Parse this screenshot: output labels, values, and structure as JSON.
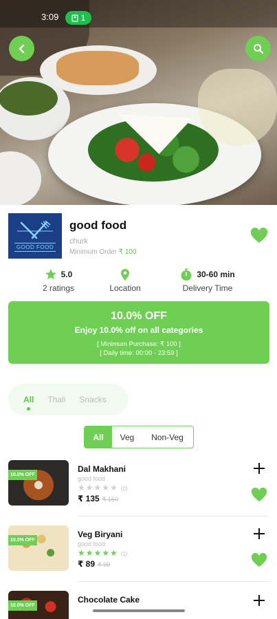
{
  "status": {
    "time": "3:09",
    "pill_count": "1"
  },
  "shop": {
    "logo_text": "GOOD FOOD",
    "name": "good food",
    "sub": "churk",
    "min_order_label": "Minimum Order",
    "min_order_value": "₹ 100"
  },
  "stats": {
    "rating_value": "5.0",
    "rating_label": "2 ratings",
    "location_label": "Location",
    "delivery_value": "30-60 min",
    "delivery_label": "Delivery Time"
  },
  "promo": {
    "title": "10.0% OFF",
    "subtitle": "Enjoy 10.0% off on all categories",
    "min_purchase": "[ Minimum Purchase: ₹ 100 ]",
    "daily_time": "[ Daily time: 00:00 - 23:59 ]"
  },
  "categories": [
    "All",
    "Thali",
    "Snacks"
  ],
  "filters": [
    "All",
    "Veg",
    "Non-Veg"
  ],
  "items": [
    {
      "name": "Dal Makhani",
      "shop": "good food",
      "rating": 0,
      "rating_count": "(0)",
      "price": "₹ 135",
      "old_price": "₹ 150",
      "badge": "10.0% OFF"
    },
    {
      "name": "Veg Biryani",
      "shop": "good food",
      "rating": 5,
      "rating_count": "(1)",
      "price": "₹ 89",
      "old_price": "₹ 99",
      "badge": "10.0% OFF"
    },
    {
      "name": "Chocolate Cake",
      "badge": "10.0% OFF"
    }
  ],
  "colors": {
    "accent": "#6fcf54",
    "logo_bg": "#1b3f86"
  }
}
